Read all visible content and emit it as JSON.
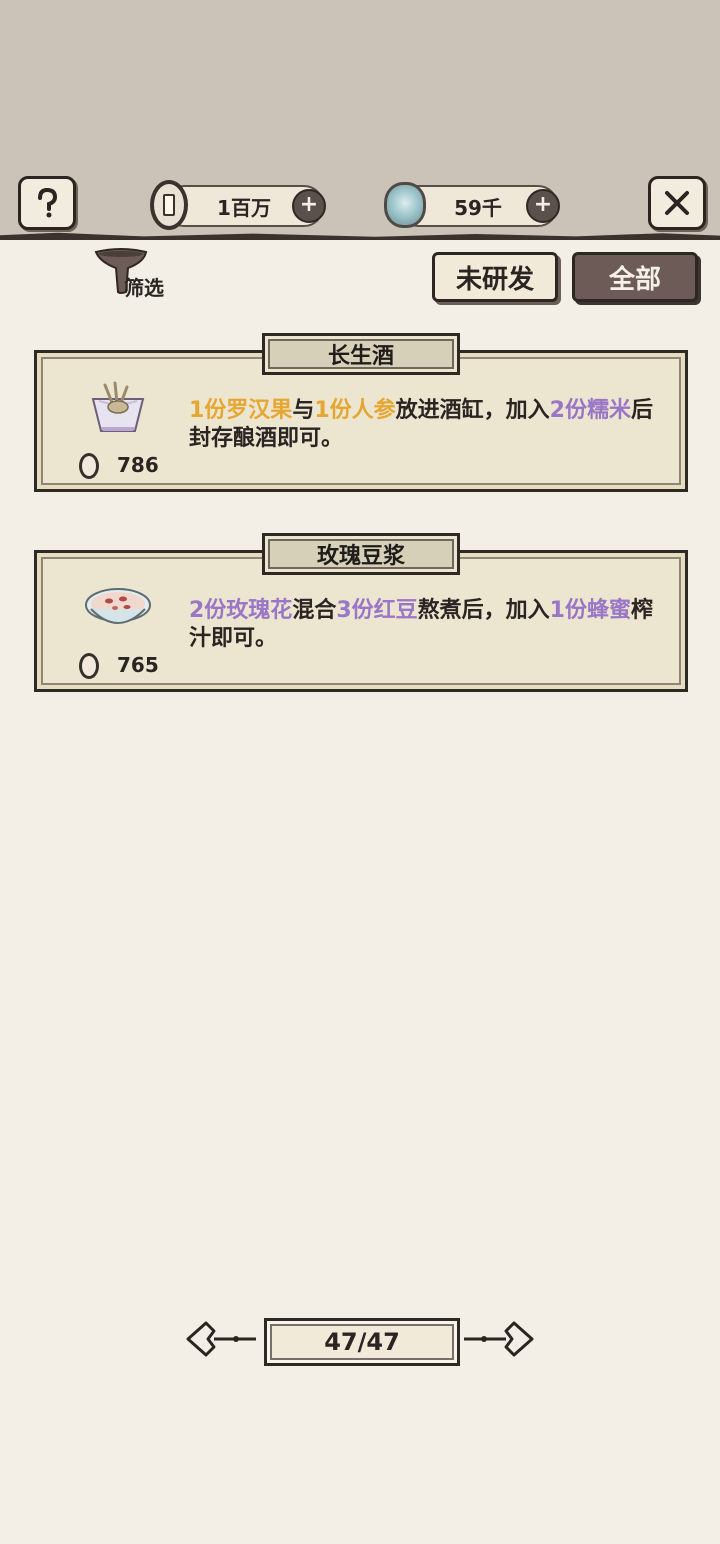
{
  "header": {
    "help_icon": "question-icon",
    "close_icon": "close-x-icon",
    "coins_value": "1百万",
    "jade_value": "59千"
  },
  "toolbar": {
    "filter_label": "筛选",
    "undeveloped_button": "未研发",
    "all_button": "全部"
  },
  "recipes": [
    {
      "title": "长生酒",
      "price": "786",
      "parts": [
        "1份罗汉果",
        "与",
        "1份人参",
        "放进酒缸，加入",
        "2份糯米",
        "后封存酿酒即可。"
      ]
    },
    {
      "title": "玫瑰豆浆",
      "price": "765",
      "parts": [
        "2份玫瑰花",
        "混合",
        "3份红豆",
        "熬煮后，加入",
        "1份蜂蜜",
        "榨汁即可。"
      ]
    }
  ],
  "pagination": {
    "label": "47/47"
  },
  "colors": {
    "highlight_gold": "#e6a632",
    "highlight_purple": "#9a76c6"
  }
}
